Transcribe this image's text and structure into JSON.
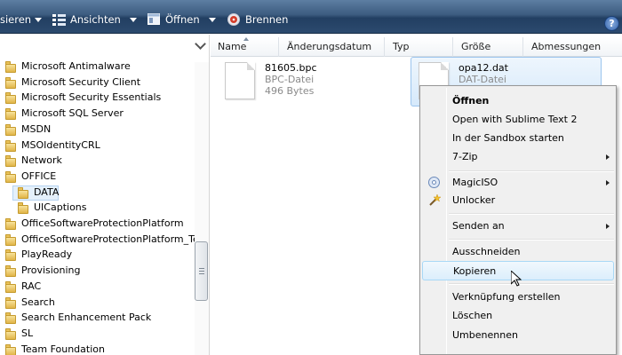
{
  "toolbar": {
    "organize_label": "sieren",
    "views_label": "Ansichten",
    "open_label": "Öffnen",
    "burn_label": "Brennen",
    "help_label": "?"
  },
  "columns": [
    "Name",
    "Änderungsdatum",
    "Typ",
    "Größe",
    "Abmessungen"
  ],
  "tree": {
    "items": [
      "Microsoft Antimalware",
      "Microsoft Security Client",
      "Microsoft Security Essentials",
      "Microsoft SQL Server",
      "MSDN",
      "MSOIdentityCRL",
      "Network",
      "OFFICE",
      "DATA",
      "UICaptions",
      "OfficeSoftwareProtectionPlatform",
      "OfficeSoftwareProtectionPlatform_Test",
      "PlayReady",
      "Provisioning",
      "RAC",
      "Search",
      "Search Enhancement Pack",
      "SL",
      "Team Foundation"
    ]
  },
  "files": [
    {
      "name": "81605.bpc",
      "type": "BPC-Datei",
      "size": "496 Bytes"
    },
    {
      "name": "opa12.dat",
      "type": "DAT-Datei",
      "size": ""
    }
  ],
  "context_menu": {
    "items": [
      "Öffnen",
      "Open with Sublime Text 2",
      "In der Sandbox starten",
      "7-Zip",
      "MagicISO",
      "Unlocker",
      "Senden an",
      "Ausschneiden",
      "Kopieren",
      "Verknüpfung erstellen",
      "Löschen",
      "Umbenennen"
    ]
  },
  "colors": {
    "toolbar": "#3c5b7f",
    "selection": "#d6e9fb",
    "menu_bg": "#f0f0f0",
    "folder": "#e1b548"
  }
}
